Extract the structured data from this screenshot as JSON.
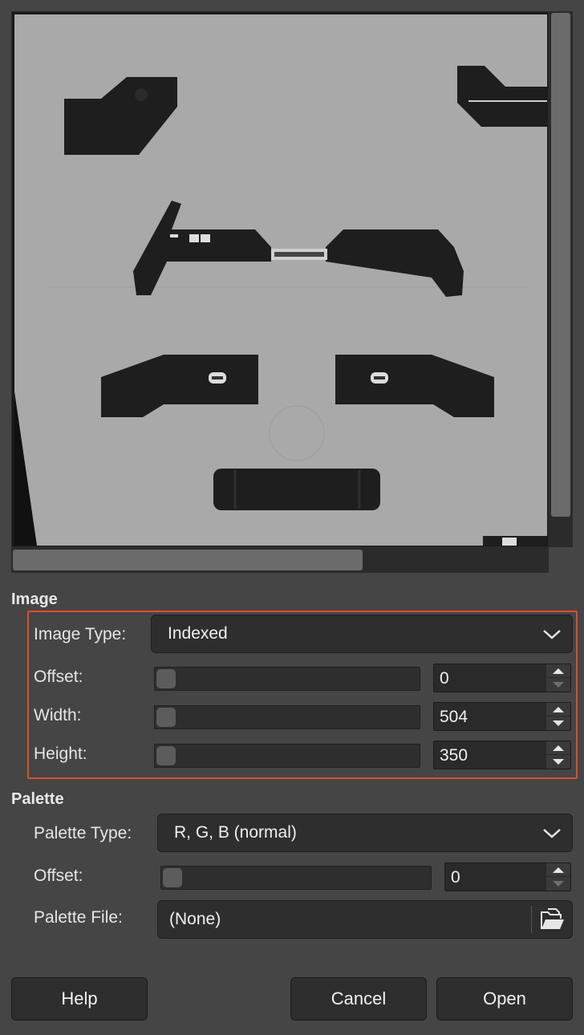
{
  "preview": {
    "canvas_color": "#a9a9a9",
    "shape_color": "#1e1e1e"
  },
  "image_section": {
    "title": "Image",
    "image_type_label": "Image Type:",
    "image_type_value": "Indexed",
    "offset_label": "Offset:",
    "offset_value": "0",
    "width_label": "Width:",
    "width_value": "504",
    "height_label": "Height:",
    "height_value": "350"
  },
  "palette_section": {
    "title": "Palette",
    "palette_type_label": "Palette Type:",
    "palette_type_value": "R, G, B (normal)",
    "offset_label": "Offset:",
    "offset_value": "0",
    "palette_file_label": "Palette File:",
    "palette_file_value": "(None)"
  },
  "buttons": {
    "help": "Help",
    "cancel": "Cancel",
    "open": "Open"
  },
  "colors": {
    "background": "#454545",
    "highlight": "#d9502c"
  }
}
